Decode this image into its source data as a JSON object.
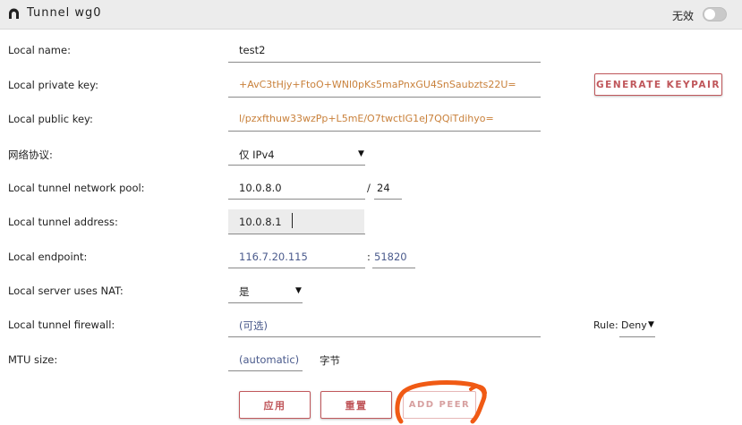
{
  "window": {
    "title": "Tunnel wg0",
    "app_icon": "tunnel-app-icon",
    "toggle_label": "无效",
    "toggle_on": false
  },
  "form": {
    "local_name": {
      "label": "Local name:",
      "value": "test2"
    },
    "private_key": {
      "label": "Local private key:",
      "value": "+AvC3tHjy+FtoO+WNl0pKs5maPnxGU4SnSaubzts22U=",
      "generate_button": "GENERATE KEYPAIR"
    },
    "public_key": {
      "label": "Local public key:",
      "value": "l/pzxfthuw33wzPp+L5mE/O7twctIG1eJ7QQiTdihyo="
    },
    "protocol": {
      "label": "网络协议:",
      "selected": "仅 IPv4"
    },
    "network_pool": {
      "label": "Local tunnel network pool:",
      "address": "10.0.8.0",
      "separator": "/",
      "prefix": "24"
    },
    "tunnel_address": {
      "label": "Local tunnel address:",
      "value": "10.0.8.1"
    },
    "endpoint": {
      "label": "Local endpoint:",
      "host": "116.7.20.115",
      "separator": ":",
      "port": "51820"
    },
    "nat": {
      "label": "Local server uses NAT:",
      "selected": "是"
    },
    "firewall": {
      "label": "Local tunnel firewall:",
      "placeholder": "(可选)",
      "rule_label": "Rule:",
      "rule_selected": "Deny"
    },
    "mtu": {
      "label": "MTU size:",
      "value": "(automatic)",
      "unit": "字节"
    }
  },
  "buttons": {
    "apply": "应用",
    "reset": "重置",
    "add_peer": "ADD PEER"
  },
  "colors": {
    "accent": "#c0575b",
    "orange_text": "#c9813b",
    "blue_text": "#4a5a8c",
    "annotation": "#f05a14"
  }
}
